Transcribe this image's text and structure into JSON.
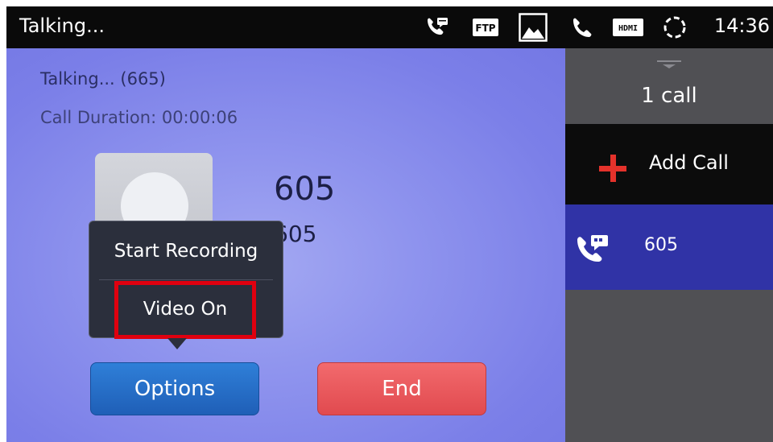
{
  "status_bar": {
    "title": "Talking...",
    "time": "14:36",
    "icons": [
      "call-chat-icon",
      "ftp-icon",
      "image-icon",
      "phone-icon",
      "hdmi-icon",
      "sync-icon"
    ],
    "ftp_label": "FTP",
    "hdmi_label": "HDMI"
  },
  "call": {
    "status": "Talking... (665)",
    "duration": "Call Duration: 00:00:06",
    "name": "605",
    "number": "605"
  },
  "popup": {
    "start_recording": "Start Recording",
    "video_on": "Video On"
  },
  "buttons": {
    "options": "Options",
    "end": "End"
  },
  "side_panel": {
    "calls_count": "1 call",
    "add_call": "Add Call",
    "active_call_number": "605"
  },
  "colors": {
    "background": "#7c7fe8",
    "highlight": "#e0000f",
    "options_button": "#2f7fd8",
    "end_button": "#f26a6d",
    "side_panel": "#505054",
    "active_call": "#3033a6",
    "add_call_plus": "#e4322b"
  }
}
